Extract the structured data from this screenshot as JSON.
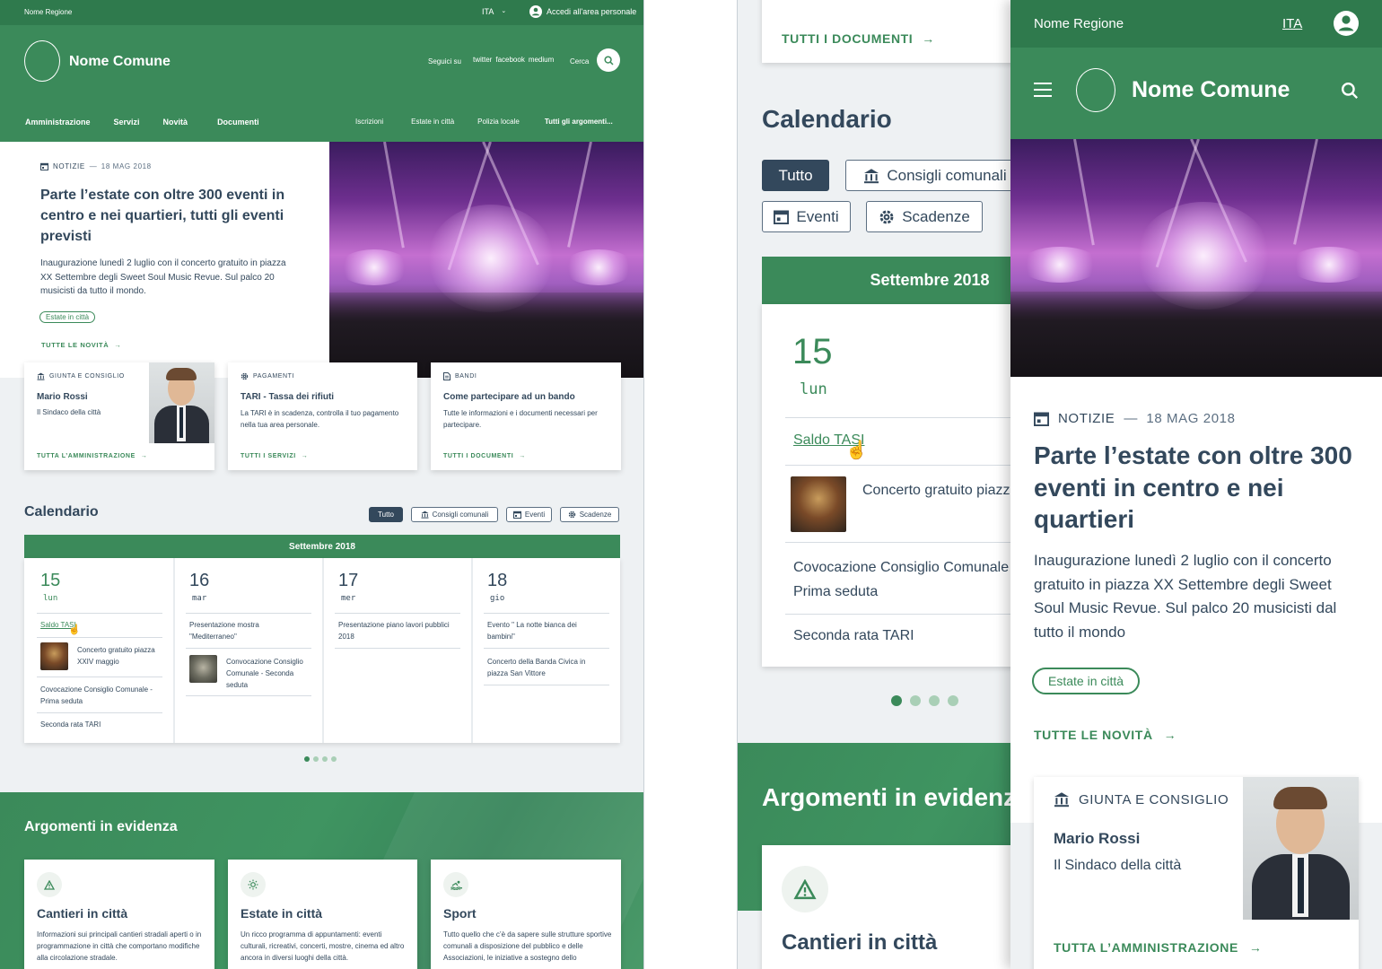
{
  "colors": {
    "primary": "#3b8a5a",
    "primary_dark": "#2f7a4d",
    "text": "#33485c",
    "muted": "#5c6f82"
  },
  "topbar": {
    "region": "Nome Regione",
    "lang": "ITA",
    "login": "Accedi all'area personale"
  },
  "header": {
    "comune": "Nome Comune",
    "follow": "Seguici su",
    "social": [
      "twitter",
      "facebook",
      "medium"
    ],
    "search": "Cerca"
  },
  "nav": {
    "main": [
      "Amministrazione",
      "Servizi",
      "Novità",
      "Documenti"
    ],
    "secondary": [
      "Iscrizioni",
      "Estate in città",
      "Polizia locale",
      "Tutti gli argomenti..."
    ]
  },
  "hero": {
    "category": "NOTIZIE",
    "date": "18 MAG 2018",
    "title": "Parte l’estate con oltre 300 eventi in centro e nei quartieri, tutti gli eventi previsti",
    "text": "Inaugurazione lunedì 2 luglio con il concerto gratuito in piazza XX Settembre degli Sweet Soul Music Revue. Sul palco 20 musicisti da tutto il mondo.",
    "tag": "Estate in città",
    "more": "TUTTE LE NOVITÀ"
  },
  "cards": [
    {
      "category": "GIUNTA E CONSIGLIO",
      "icon": "institution-icon",
      "title": "Mario Rossi",
      "text": "Il Sindaco della città",
      "link": "TUTTA L’AMMINISTRAZIONE"
    },
    {
      "category": "PAGAMENTI",
      "icon": "gear-icon",
      "title": "TARI - Tassa dei rifiuti",
      "text": "La TARI è in scadenza, controlla il tuo pagamento nella tua area personale.",
      "link": "TUTTI I SERVIZI"
    },
    {
      "category": "BANDI",
      "icon": "document-icon",
      "title": "Come partecipare ad un bando",
      "text": "Tutte le informazioni e i documenti necessari per partecipare.",
      "link": "TUTTI I DOCUMENTI"
    }
  ],
  "calendar": {
    "title": "Calendario",
    "filters": [
      "Tutto",
      "Consigli comunali",
      "Eventi",
      "Scadenze"
    ],
    "month": "Settembre 2018",
    "days": [
      {
        "num": "15",
        "dow": "lun",
        "events": [
          "Saldo TASI",
          "Concerto gratuito piazza XXIV maggio",
          "Covocazione Consiglio Comunale - Prima seduta",
          "Seconda rata TARI"
        ]
      },
      {
        "num": "16",
        "dow": "mar",
        "events": [
          "Presentazione mostra \"Mediterraneo\"",
          "Convocazione Consiglio Comunale - Seconda seduta"
        ]
      },
      {
        "num": "17",
        "dow": "mer",
        "events": [
          "Presentazione piano lavori pubblici 2018"
        ]
      },
      {
        "num": "18",
        "dow": "gio",
        "events": [
          "Evento \" La notte bianca dei bambini\"",
          "Concerto della Banda Civica in piazza San Vittore"
        ]
      }
    ]
  },
  "topics": {
    "title": "Argomenti in evidenza",
    "items": [
      {
        "title": "Cantieri in città",
        "icon": "warning-icon",
        "text": "Informazioni sui principali cantieri stradali aperti o in programmazione in città che comportano modifiche alla circolazione stradale."
      },
      {
        "title": "Estate in città",
        "icon": "sun-icon",
        "text": "Un ricco programma di appuntamenti: eventi culturali, ricreativi, concerti, mostre, cinema ed altro ancora in diversi luoghi della città."
      },
      {
        "title": "Sport",
        "icon": "swimmer-icon",
        "text": "Tutto quello che c’è da sapere sulle strutture sportive comunali a disposizione del pubblico e delle Associazioni, le iniziative a sostegno dello"
      }
    ]
  },
  "tablet": {
    "docs_link": "TUTTI I DOCUMENTI",
    "calendar_title": "Calendario",
    "filters": [
      "Tutto",
      "Consigli comunali",
      "Eventi",
      "Scadenze"
    ],
    "month": "Settembre 2018",
    "day_num": "15",
    "day_dow": "lun",
    "events": [
      "Saldo TASI",
      "Concerto gratuito piazza XXIV maggio",
      "Covocazione Consiglio Comunale - Prima seduta",
      "Seconda rata TARI"
    ],
    "topics_title": "Argomenti in evidenza",
    "topic_title": "Cantieri in città"
  },
  "mobile": {
    "region": "Nome Regione",
    "lang": "ITA",
    "comune": "Nome Comune",
    "category": "NOTIZIE",
    "date": "18 MAG 2018",
    "title": "Parte l’estate con oltre 300 eventi in centro e nei quartieri",
    "text": "Inaugurazione lunedì 2 luglio con il concerto gratuito in piazza XX Settembre degli Sweet Soul Music Revue. Sul palco 20 musicisti dal tutto il mondo",
    "tag": "Estate in città",
    "more": "TUTTE LE NOVITÀ",
    "card_category": "GIUNTA E CONSIGLIO",
    "card_title": "Mario Rossi",
    "card_text": "Il Sindaco della città",
    "card_link": "TUTTA L’AMMINISTRAZIONE"
  }
}
